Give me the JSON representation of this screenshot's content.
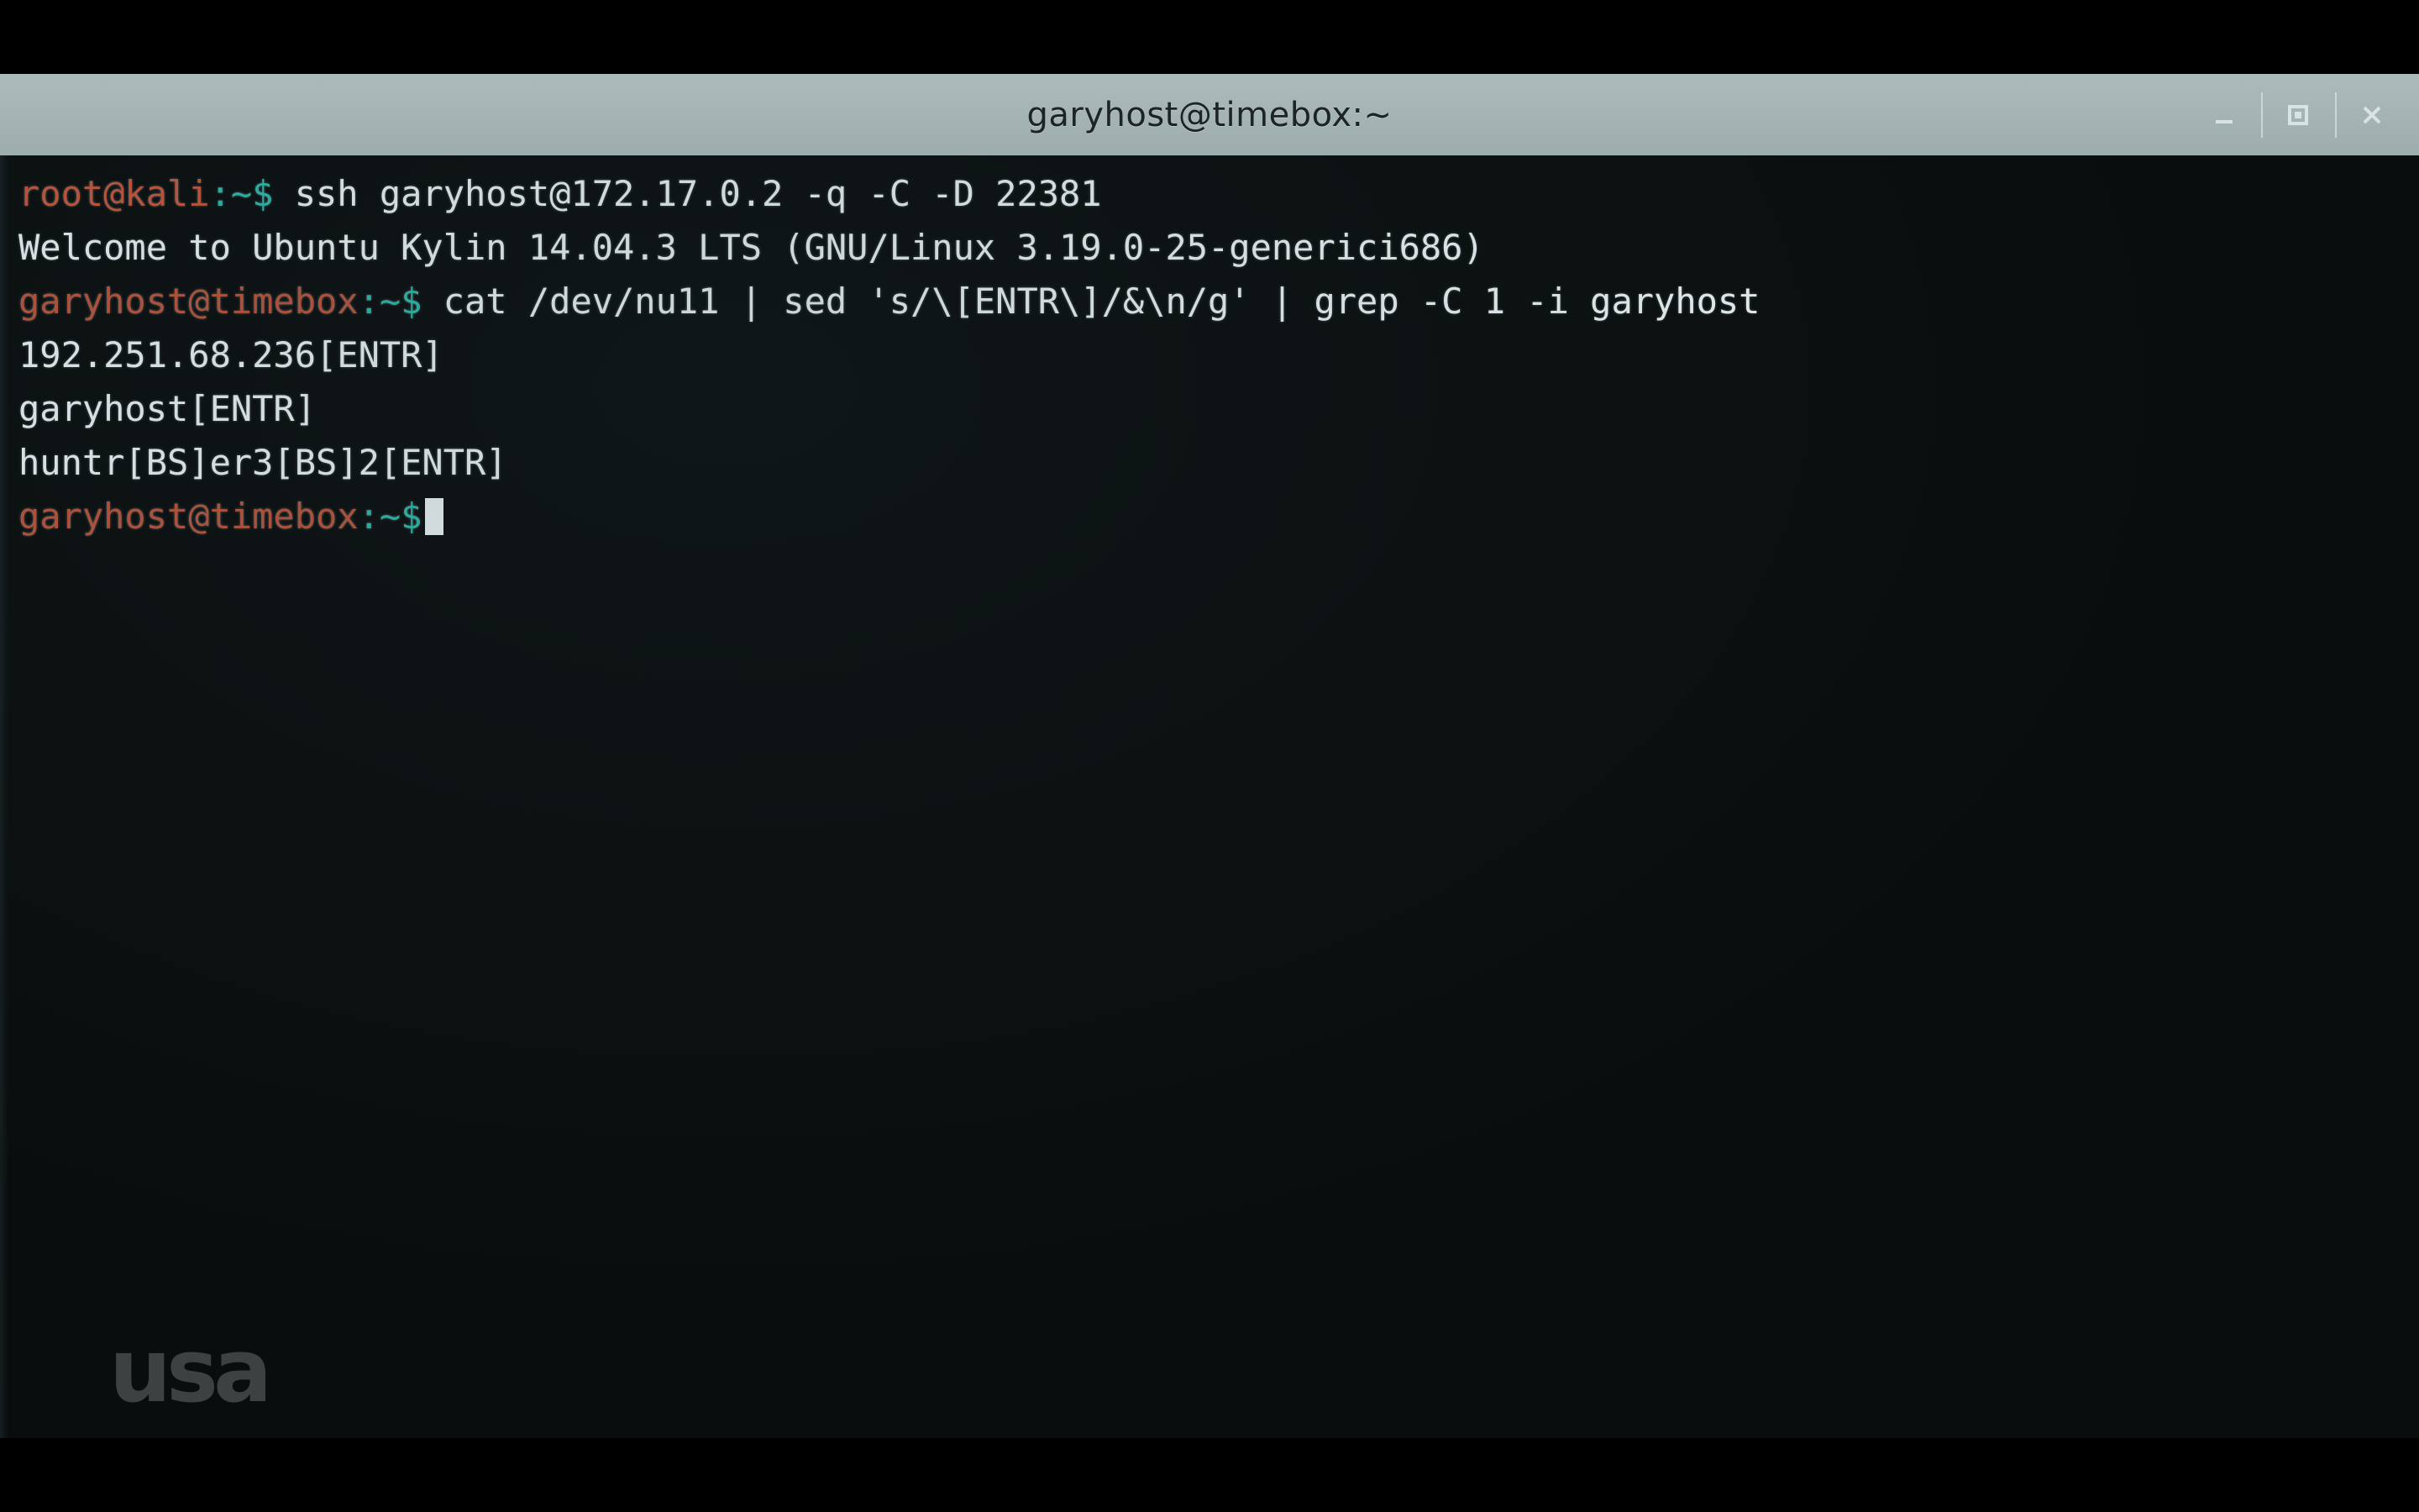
{
  "window": {
    "title": "garyhost@timebox:~",
    "controls": [
      {
        "name": "minimize-button",
        "label": "—"
      },
      {
        "name": "maximize-button",
        "label": "□"
      },
      {
        "name": "close-button",
        "label": "✕"
      }
    ]
  },
  "colors": {
    "titlebar": "#a4b3b3",
    "terminal_bg": "#0a0d0d",
    "text": "#e8eef0",
    "prompt_user": "#c1553a",
    "prompt_path": "#2fb6a8"
  },
  "terminal": {
    "lines": [
      {
        "type": "prompt-command",
        "prompt_user": "root@kali",
        "prompt_path": ":~$",
        "command": " ssh garyhost@172.17.0.2 -q -C -D 22381"
      },
      {
        "type": "output",
        "text": "Welcome to Ubuntu Kylin 14.04.3 LTS (GNU/Linux 3.19.0-25-generici686)"
      },
      {
        "type": "prompt-command",
        "prompt_user": "garyhost@timebox",
        "prompt_path": ":~$",
        "command": " cat /dev/nu11 | sed 's/\\[ENTR\\]/&\\n/g' | grep -C 1 -i garyhost"
      },
      {
        "type": "output",
        "text": "192.251.68.236[ENTR]"
      },
      {
        "type": "output",
        "text": "garyhost[ENTR]"
      },
      {
        "type": "output",
        "text": "huntr[BS]er3[BS]2[ENTR]"
      },
      {
        "type": "prompt-cursor",
        "prompt_user": "garyhost@timebox",
        "prompt_path": ":~$",
        "command": " "
      }
    ]
  },
  "watermark": {
    "name": "usa-network-logo",
    "text": "usa"
  }
}
